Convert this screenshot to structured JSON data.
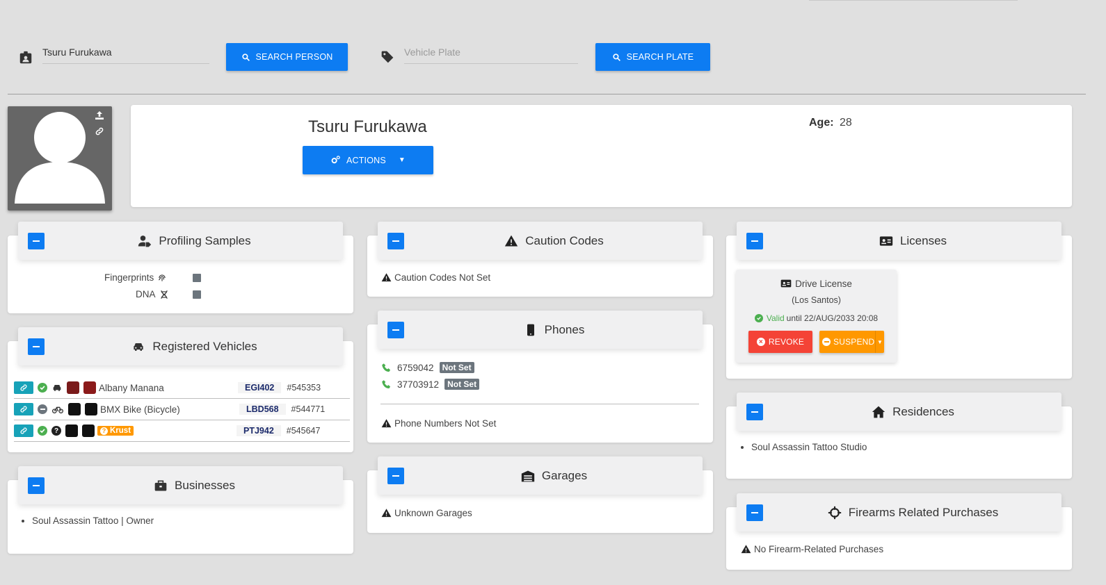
{
  "search": {
    "person_value": "Tsuru Furukawa",
    "person_button": "SEARCH PERSON",
    "plate_placeholder": "Vehicle Plate",
    "plate_button": "SEARCH PLATE"
  },
  "profile": {
    "name": "Tsuru Furukawa",
    "actions_label": "ACTIONS",
    "age_label": "Age:",
    "age_value": "28"
  },
  "profiling": {
    "title": "Profiling Samples",
    "fingerprints_label": "Fingerprints",
    "dna_label": "DNA"
  },
  "vehicles": {
    "title": "Registered Vehicles",
    "rows": [
      {
        "name": "Albany Manana",
        "plate": "EGI402",
        "id": "545353",
        "color1": "#7a1a1a",
        "color2": "#8b1a1a",
        "status": "valid",
        "type_icon": "car-icon",
        "tag": ""
      },
      {
        "name": "BMX Bike (Bicycle)",
        "plate": "LBD568",
        "id": "544771",
        "color1": "#111111",
        "color2": "#111111",
        "status": "neutral",
        "type_icon": "bike-icon",
        "tag": ""
      },
      {
        "name": "",
        "plate": "PTJ942",
        "id": "545647",
        "color1": "#111111",
        "color2": "#111111",
        "status": "valid",
        "type_icon": "question-icon",
        "tag": "Krust"
      }
    ]
  },
  "businesses": {
    "title": "Businesses",
    "items": [
      "Soul Assassin Tattoo | Owner"
    ]
  },
  "caution": {
    "title": "Caution Codes",
    "text": "Caution Codes Not Set"
  },
  "phones": {
    "title": "Phones",
    "items": [
      {
        "number": "6759042",
        "badge": "Not Set"
      },
      {
        "number": "37703912",
        "badge": "Not Set"
      }
    ],
    "footer": "Phone Numbers Not Set"
  },
  "garages": {
    "title": "Garages",
    "text": "Unknown Garages"
  },
  "licenses": {
    "title": "Licenses",
    "license_name": "Drive License",
    "region": "(Los Santos)",
    "valid_word": "Valid",
    "valid_until": "until 22/AUG/2033 20:08",
    "revoke_label": "REVOKE",
    "suspend_label": "SUSPEND"
  },
  "residences": {
    "title": "Residences",
    "items": [
      "Soul Assassin Tattoo Studio"
    ]
  },
  "firearms": {
    "title": "Firearms Related Purchases",
    "text": "No Firearm-Related Purchases"
  },
  "colors": {
    "primary": "#0d7cf2",
    "danger": "#f44336",
    "warning": "#ff9800",
    "success": "#4caf50",
    "info": "#17a2b8"
  }
}
